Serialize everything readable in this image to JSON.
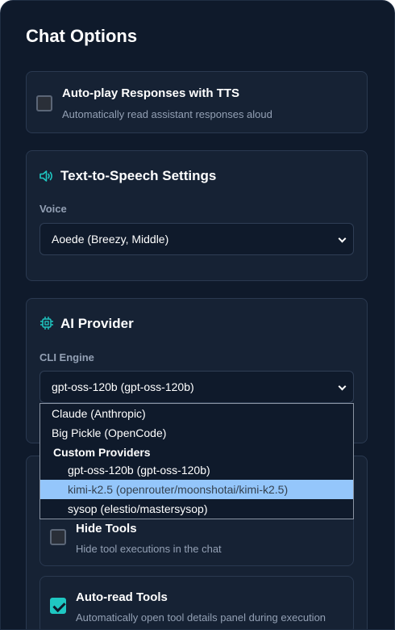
{
  "panel": {
    "title": "Chat Options"
  },
  "autoplay": {
    "title": "Auto-play Responses with TTS",
    "description": "Automatically read assistant responses aloud",
    "checked": false
  },
  "tts": {
    "title": "Text-to-Speech Settings",
    "icon": "speaker-icon",
    "voice_label": "Voice",
    "voice_value": "Aoede (Breezy, Middle)"
  },
  "provider": {
    "title": "AI Provider",
    "icon": "chip-icon",
    "engine_label": "CLI Engine",
    "engine_value": "gpt-oss-120b (gpt-oss-120b)"
  },
  "dropdown": {
    "options": [
      {
        "label": "Claude (Anthropic)",
        "type": "option"
      },
      {
        "label": "Big Pickle (OpenCode)",
        "type": "option"
      },
      {
        "label": "Custom Providers",
        "type": "group"
      },
      {
        "label": "gpt-oss-120b (gpt-oss-120b)",
        "type": "sub"
      },
      {
        "label": "kimi-k2.5 (openrouter/moonshotai/kimi-k2.5)",
        "type": "sub",
        "highlighted": true
      },
      {
        "label": "sysop (elestio/mastersysop)",
        "type": "sub"
      }
    ]
  },
  "tools": {
    "hide": {
      "title": "Hide Tools",
      "description": "Hide tool executions in the chat",
      "checked": false
    },
    "autoread": {
      "title": "Auto-read Tools",
      "description": "Automatically open tool details panel during execution",
      "checked": true
    }
  },
  "colors": {
    "background": "#0f1a2b",
    "card": "#162234",
    "accent": "#1fc7c2",
    "highlight": "#94c6fb"
  }
}
